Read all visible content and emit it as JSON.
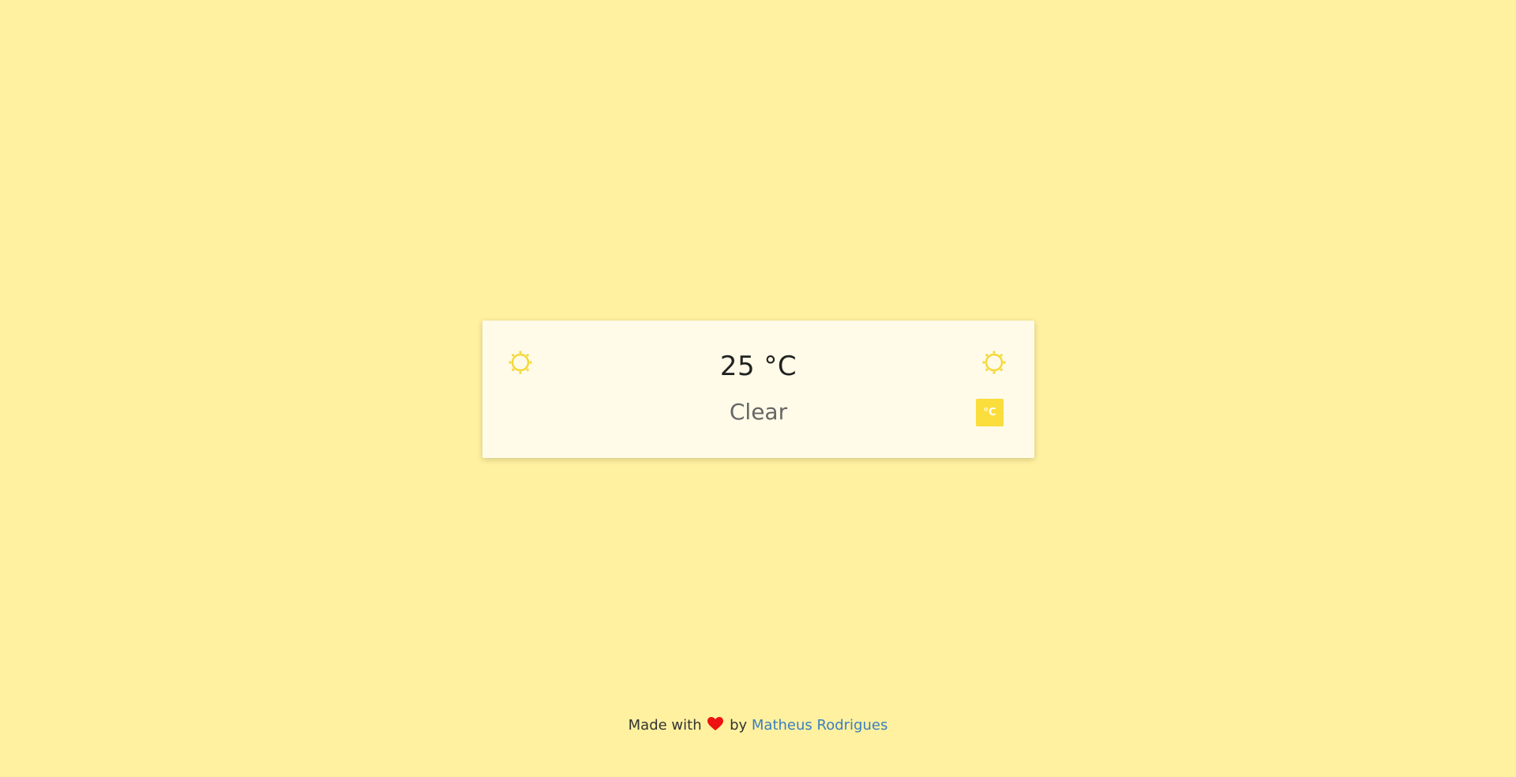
{
  "weather": {
    "temperature": "25 °C",
    "condition": "Clear",
    "unit_toggle_label": "°C",
    "icon_left": "sun-icon",
    "icon_right": "sun-icon"
  },
  "footer": {
    "made_with": "Made with",
    "by": "by",
    "author": "Matheus Rodrigues",
    "heart_icon": "heart-icon"
  },
  "colors": {
    "background": "#fff19f",
    "card": "#fffbe8",
    "accent": "#fbdd3c",
    "heart": "#ee1111",
    "link": "#3a7ec0"
  }
}
